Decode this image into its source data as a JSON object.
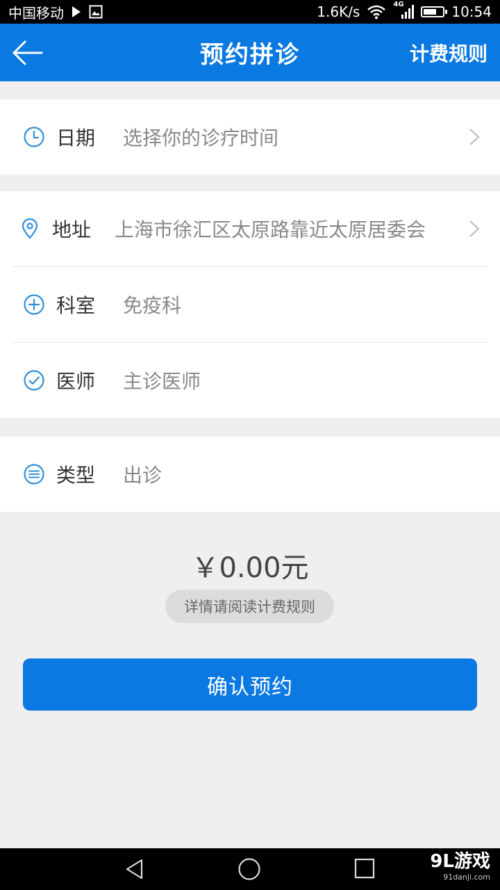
{
  "status_bar": {
    "carrier": "中国移动",
    "network_speed": "1.6K/s",
    "network_type": "4G",
    "time": "10:54",
    "battery_level": 0.7
  },
  "app_bar": {
    "title": "预约拼诊",
    "action_label": "计费规则"
  },
  "form": {
    "date": {
      "label": "日期",
      "value": "选择你的诊疗时间",
      "icon": "clock-icon"
    },
    "address": {
      "label": "地址",
      "value": "上海市徐汇区太原路靠近太原居委会",
      "icon": "location-pin-icon"
    },
    "department": {
      "label": "科室",
      "value": "免疫科",
      "icon": "plus-circle-icon"
    },
    "doctor": {
      "label": "医师",
      "value": "主诊医师",
      "icon": "check-circle-icon"
    },
    "type": {
      "label": "类型",
      "value": "出诊",
      "icon": "list-circle-icon"
    }
  },
  "pricing": {
    "price": "￥0.00元",
    "note": "详情请阅读计费规则"
  },
  "confirm_label": "确认预约",
  "watermark": {
    "brand": "9L游戏",
    "site": "91danji.com"
  },
  "colors": {
    "accent": "#0a79e1",
    "icon": "#2f8fd8",
    "background": "#efefef"
  }
}
